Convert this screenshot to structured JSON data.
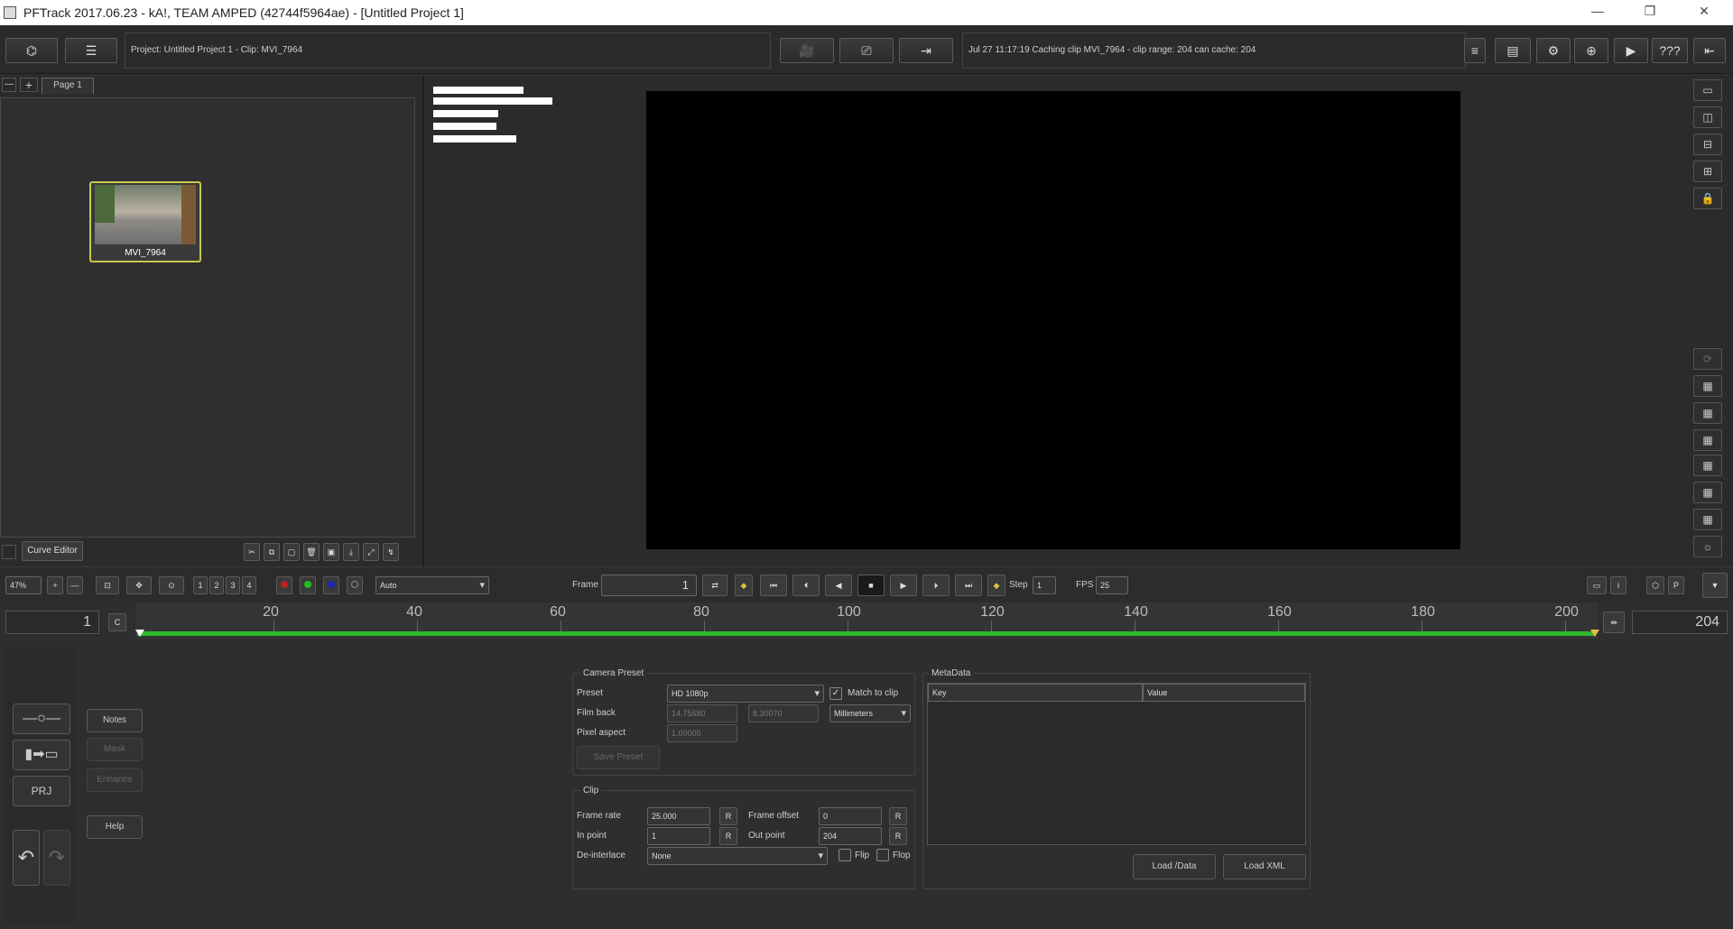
{
  "window": {
    "title": "PFTrack 2017.06.23 - kA!, TEAM AMPED (42744f5964ae) - [Untitled Project 1]"
  },
  "toolbar": {
    "project_info": "Project: Untitled Project 1 - Clip: MVI_7964",
    "status": "Jul 27 11:17:19 Caching clip MVI_7964 - clip range: 204 can cache: 204",
    "help_label": "???"
  },
  "tree": {
    "page_tab": "Page 1",
    "node_label": "MVI_7964",
    "curve_editor": "Curve Editor"
  },
  "controls": {
    "zoom": "47%",
    "num_buttons": [
      "1",
      "2",
      "3",
      "4"
    ],
    "channel_select": "Auto",
    "frame_label": "Frame",
    "frame_value": "1",
    "step_label": "Step",
    "step_value": "1",
    "fps_label": "FPS",
    "fps_value": "25",
    "p_button": "P"
  },
  "timeline": {
    "start_frame": "1",
    "c_button": "C",
    "end_frame": "204",
    "ticks": [
      "20",
      "40",
      "60",
      "80",
      "100",
      "120",
      "140",
      "160",
      "180",
      "200"
    ]
  },
  "left_buttons": {
    "notes": "Notes",
    "mask": "Mask",
    "enhance": "Enhance",
    "help": "Help",
    "prj": "PRJ"
  },
  "camera_preset": {
    "group": "Camera Preset",
    "preset_label": "Preset",
    "preset_value": "HD 1080p",
    "match_label": "Match to clip",
    "filmback_label": "Film back",
    "filmback_w": "14.75680",
    "filmback_h": "8.30070",
    "units": "Millimeters",
    "pixel_aspect_label": "Pixel aspect",
    "pixel_aspect": "1.00000",
    "save_preset": "Save Preset"
  },
  "clip": {
    "group": "Clip",
    "frame_rate_label": "Frame rate",
    "frame_rate": "25.000",
    "r": "R",
    "frame_offset_label": "Frame offset",
    "frame_offset": "0",
    "in_point_label": "In point",
    "in_point": "1",
    "out_point_label": "Out point",
    "out_point": "204",
    "deinterlace_label": "De-interlace",
    "deinterlace_value": "None",
    "flip_label": "Flip",
    "flop_label": "Flop"
  },
  "metadata": {
    "group": "MetaData",
    "col_key": "Key",
    "col_value": "Value",
    "load_idata": "Load /Data",
    "load_xml": "Load XML"
  }
}
